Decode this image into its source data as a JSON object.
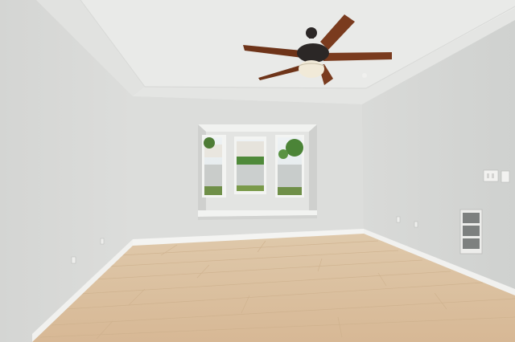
{
  "scene": {
    "subject": "empty-room",
    "elements": [
      "ceiling-fan",
      "bay-window",
      "wood-floor",
      "air-vent",
      "light-switch",
      "power-outlet"
    ],
    "colors": {
      "wall_left": "#d6d7d5",
      "wall_back": "#dcdddb",
      "wall_right": "#d3d5d3",
      "ceiling": "#eaebe9",
      "floor": "#dcc3a3",
      "baseboard": "#f4f4f2",
      "fan_blade": "#7a3b1e",
      "fan_body": "#2b2726",
      "window_trim": "#f2f3f1",
      "foliage": "#4f8a3a"
    }
  }
}
